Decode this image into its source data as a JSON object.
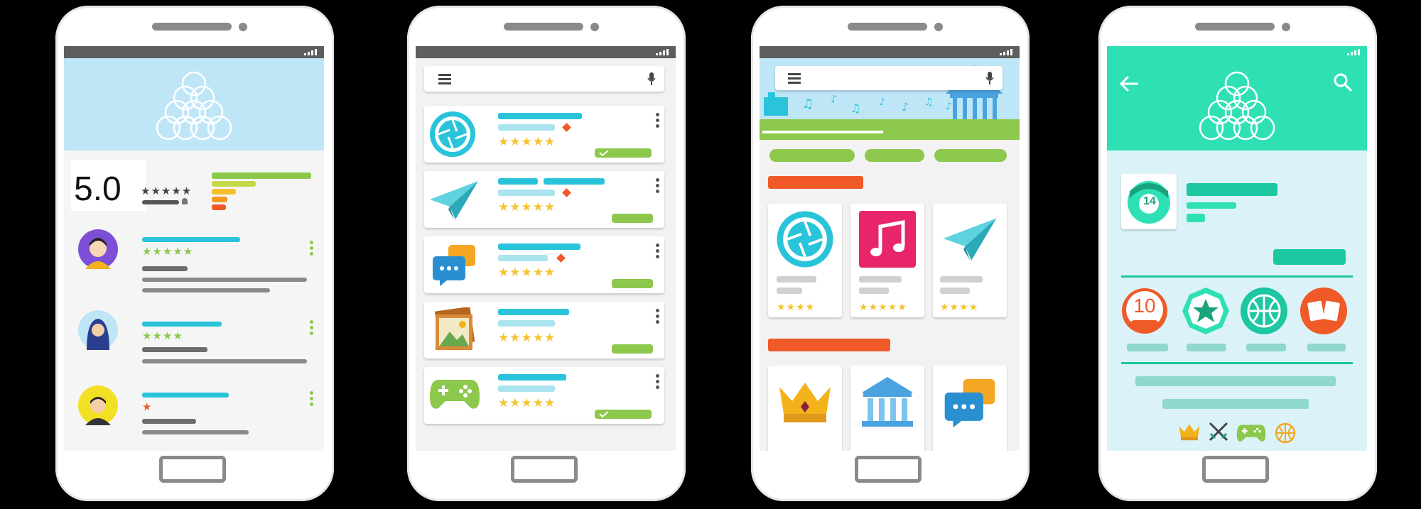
{
  "phone1": {
    "rating_value": "5.0",
    "rating_stars": "★★★★★",
    "reviews": [
      {
        "stars": "★★★★★"
      },
      {
        "stars": "★★★★"
      },
      {
        "stars": "★"
      }
    ]
  },
  "phone2": {
    "apps": [
      {
        "icon": "camera-aperture-icon",
        "stars": "★★★★★"
      },
      {
        "icon": "paper-plane-icon",
        "stars": "★★★★★"
      },
      {
        "icon": "chat-bubbles-icon",
        "stars": "★★★★★"
      },
      {
        "icon": "photo-gallery-icon",
        "stars": "★★★★★"
      },
      {
        "icon": "gamepad-icon",
        "stars": "★★★★★"
      }
    ]
  },
  "phone3": {
    "tiles": [
      {
        "icon": "camera-aperture-icon",
        "stars": "★★★★"
      },
      {
        "icon": "music-note-icon",
        "stars": "★★★★★"
      },
      {
        "icon": "paper-plane-icon",
        "stars": "★★★★"
      }
    ],
    "tiles_row2": [
      "crown-icon",
      "bank-building-icon",
      "chat-bubbles-icon"
    ]
  },
  "phone4": {
    "badge_number": "14",
    "achievement_number": "10",
    "bottom_icons": [
      "crown-icon",
      "crossed-swords-icon",
      "gamepad-icon",
      "basketball-icon"
    ]
  },
  "colors": {
    "cyan": "#29c4da",
    "light_cyan": "#a9e4ef",
    "teal": "#2fe0b5",
    "green": "#8cc84b",
    "orange": "#f05a28",
    "star": "#f4c430",
    "gray": "#6d6d6d"
  }
}
